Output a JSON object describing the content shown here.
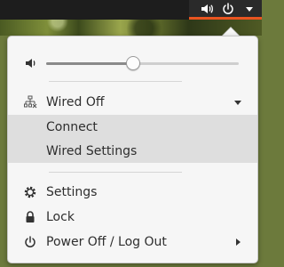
{
  "panel": {
    "volume_icon": "speaker-volume-icon",
    "power_icon": "power-icon",
    "menu_arrow_icon": "chevron-down-icon",
    "accent_color": "#e95420"
  },
  "volume": {
    "icon": "speaker-volume-icon",
    "level": 0.45
  },
  "network": {
    "label": "Wired Off",
    "icon": "wired-network-off-icon",
    "expand_icon": "chevron-down-icon",
    "submenu": {
      "connect_label": "Connect",
      "settings_label": "Wired Settings"
    }
  },
  "system": {
    "settings_label": "Settings",
    "settings_icon": "gear-icon",
    "lock_label": "Lock",
    "lock_icon": "lock-icon",
    "power_label": "Power Off / Log Out",
    "power_icon": "power-icon",
    "power_expand_icon": "chevron-right-icon"
  }
}
